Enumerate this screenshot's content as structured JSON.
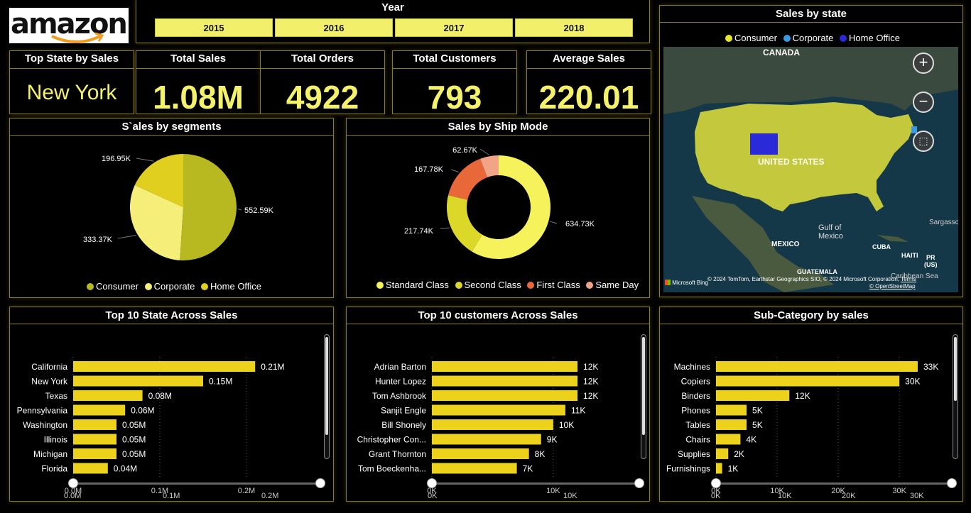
{
  "logo": {
    "text": "amazon"
  },
  "year_slicer": {
    "title": "Year",
    "options": [
      "2015",
      "2016",
      "2017",
      "2018"
    ]
  },
  "kpis": {
    "top_state": {
      "title": "Top State by Sales",
      "value": "New York"
    },
    "total_sales": {
      "title": "Total Sales",
      "value": "1.08M"
    },
    "total_orders": {
      "title": "Total Orders",
      "value": "4922"
    },
    "total_customers": {
      "title": "Total Customers",
      "value": "793"
    },
    "average_sales": {
      "title": "Average Sales",
      "value": "220.01"
    }
  },
  "map": {
    "title": "Sales by state",
    "legend": [
      "Consumer",
      "Corporate",
      "Home Office"
    ],
    "labels": {
      "canada": "CANADA",
      "us": "UNITED STATES",
      "gulf": "Gulf of\nMexico",
      "mexico": "MEXICO",
      "cuba": "CUBA",
      "haiti": "HAITI",
      "pr": "PR\n(US)",
      "guatemala": "GUATEMALA",
      "caribbean": "Caribbean Sea",
      "sargasso": "Sargasso"
    },
    "attribution": "© 2024 TomTom, Earthstar Geographics SIO, © 2024 Microsoft Corporation,",
    "terms": "Terms",
    "osm": "© OpenStreetMap",
    "bing": "Microsoft Bing",
    "zoom_in": "+",
    "zoom_out": "−"
  },
  "colors": {
    "consumer": "#b8b820",
    "corporate": "#f5ef7a",
    "home_office": "#e0cf1e",
    "standard": "#f6f25c",
    "second": "#dcd82a",
    "first": "#e8683a",
    "same_day": "#f2a487",
    "bar": "#ecd21a",
    "map_consumer": "#dcdc3a",
    "map_corporate": "#3a9ae0",
    "map_home": "#2a2ad8"
  },
  "chart_data": [
    {
      "type": "pie",
      "title": "S`ales by segments",
      "categories": [
        "Consumer",
        "Corporate",
        "Home Office"
      ],
      "values": [
        552.59,
        333.37,
        196.95
      ],
      "labels": [
        "552.59K",
        "333.37K",
        "196.95K"
      ]
    },
    {
      "type": "pie",
      "title": "Sales by Ship Mode",
      "categories": [
        "Standard Class",
        "Second Class",
        "First Class",
        "Same Day"
      ],
      "values": [
        634.73,
        217.74,
        167.78,
        62.67
      ],
      "labels": [
        "634.73K",
        "217.74K",
        "167.78K",
        "62.67K"
      ]
    },
    {
      "type": "bar",
      "title": "Top 10 State Across Sales",
      "categories": [
        "California",
        "New York",
        "Texas",
        "Pennsylvania",
        "Washington",
        "Illinois",
        "Michigan",
        "Florida"
      ],
      "values": [
        0.21,
        0.15,
        0.08,
        0.06,
        0.05,
        0.05,
        0.05,
        0.04
      ],
      "labels": [
        "0.21M",
        "0.15M",
        "0.08M",
        "0.06M",
        "0.05M",
        "0.05M",
        "0.05M",
        "0.04M"
      ],
      "xticks": [
        "0.0M",
        "0.1M",
        "0.2M"
      ],
      "xlim": [
        0,
        0.25
      ],
      "slider_ticks": [
        "0.0M",
        "0.1M",
        "0.2M"
      ]
    },
    {
      "type": "bar",
      "title": "Top 10 customers Across Sales",
      "categories": [
        "Adrian Barton",
        "Hunter Lopez",
        "Tom Ashbrook",
        "Sanjit Engle",
        "Bill Shonely",
        "Christopher Con...",
        "Grant Thornton",
        "Tom Boeckenha..."
      ],
      "values": [
        12,
        12,
        12,
        11,
        10,
        9,
        8,
        7
      ],
      "labels": [
        "12K",
        "12K",
        "12K",
        "11K",
        "10K",
        "9K",
        "8K",
        "7K"
      ],
      "xticks": [
        "0K",
        "10K"
      ],
      "xlim": [
        0,
        17.5
      ],
      "slider_ticks": [
        "0K",
        "10K"
      ]
    },
    {
      "type": "bar",
      "title": "Sub-Category by sales",
      "categories": [
        "Machines",
        "Copiers",
        "Binders",
        "Phones",
        "Tables",
        "Chairs",
        "Supplies",
        "Furnishings"
      ],
      "values": [
        33,
        30,
        12,
        5,
        5,
        4,
        2,
        1
      ],
      "labels": [
        "33K",
        "30K",
        "12K",
        "5K",
        "5K",
        "4K",
        "2K",
        "1K"
      ],
      "xticks": [
        "0K",
        "10K",
        "20K",
        "30K"
      ],
      "xlim": [
        0,
        38
      ],
      "slider_ticks": [
        "0K",
        "10K",
        "20K",
        "30K"
      ]
    }
  ]
}
